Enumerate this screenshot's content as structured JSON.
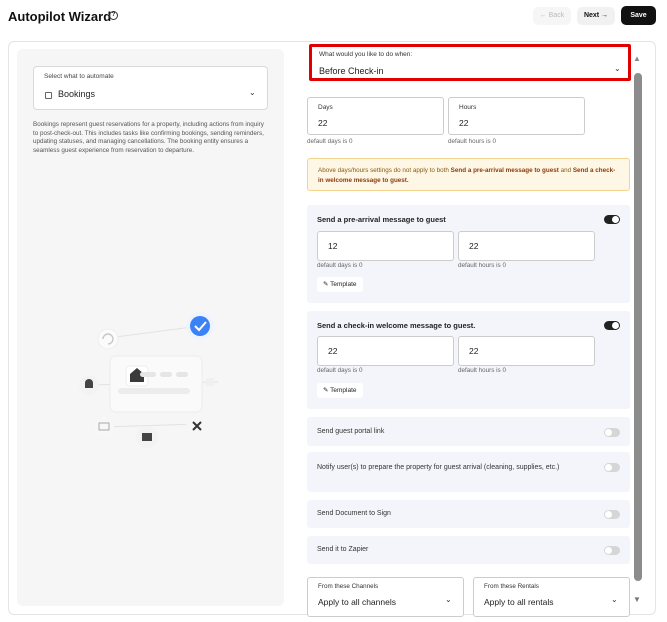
{
  "header": {
    "title": "Autopilot Wizard",
    "back_label": "← Back",
    "next_label": "Next →",
    "save_label": "Save"
  },
  "left": {
    "select_label": "Select what to automate",
    "select_value": "Bookings",
    "description": "Bookings represent guest reservations for a property, including actions from inquiry to post-check-out. This includes tasks like confirming bookings, sending reminders, updating statuses, and managing cancellations. The booking entity ensures a seamless guest experience from reservation to departure."
  },
  "trigger": {
    "label": "What would you like to do when:",
    "value": "Before Check-in"
  },
  "timing": {
    "days_label": "Days",
    "days_value": "22",
    "days_hint": "default days is 0",
    "hours_label": "Hours",
    "hours_value": "22",
    "hours_hint": "default hours is 0"
  },
  "warning": {
    "prefix": "Above days/hours settings do not apply to both",
    "item1": "Send a pre-arrival message to guest",
    "joiner": "and",
    "item2": "Send a check-in welcome message to guest."
  },
  "pre_arrival": {
    "title": "Send a pre-arrival message to guest",
    "enabled": true,
    "days": "12",
    "hours": "22",
    "days_hint": "default days is 0",
    "hours_hint": "default hours is 0",
    "template_label": "Template"
  },
  "checkin": {
    "title": "Send a check-in welcome message to guest.",
    "enabled": true,
    "days": "22",
    "hours": "22",
    "days_hint": "default days is 0",
    "hours_hint": "default hours is 0",
    "template_label": "Template"
  },
  "options": [
    {
      "label": "Send guest portal link",
      "enabled": false
    },
    {
      "label": "Notify user(s) to prepare the property for guest arrival (cleaning, supplies, etc.)",
      "enabled": false
    },
    {
      "label": "Send Document to Sign",
      "enabled": false
    },
    {
      "label": "Send it to Zapier",
      "enabled": false
    }
  ],
  "filters": {
    "channels_label": "From these Channels",
    "channels_value": "Apply to all channels",
    "rentals_label": "From these Rentals",
    "rentals_value": "Apply to all rentals"
  },
  "colors": {
    "highlight": "#e00000",
    "card_bg": "#f3f5fb",
    "warning_bg": "#fff7e6",
    "accent_check": "#3b82f6"
  }
}
